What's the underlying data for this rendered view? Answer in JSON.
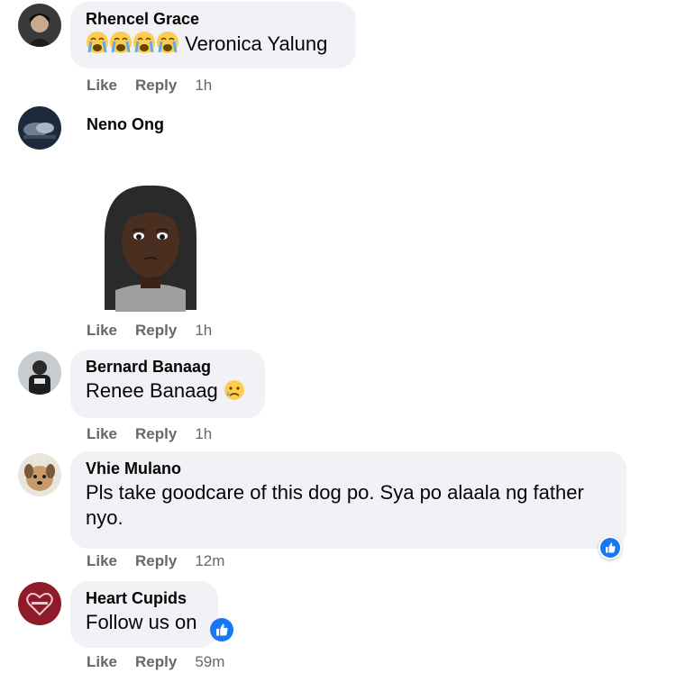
{
  "comments": [
    {
      "author": "Rhencel Grace",
      "text": "Veronica Yalung",
      "emoji_prefix": [
        "crying-face",
        "crying-face",
        "crying-face",
        "crying-face"
      ],
      "actions": {
        "like": "Like",
        "reply": "Reply",
        "time": "1h"
      }
    },
    {
      "author": "Neno Ong",
      "sticker": "avatar-sticker-sad",
      "actions": {
        "like": "Like",
        "reply": "Reply",
        "time": "1h"
      }
    },
    {
      "author": "Bernard Banaag",
      "text": "Renee Banaag",
      "emoji_suffix": "sad-tear-face",
      "actions": {
        "like": "Like",
        "reply": "Reply",
        "time": "1h"
      }
    },
    {
      "author": "Vhie Mulano",
      "text": "Pls take goodcare of this dog po. Sya po alaala ng father nyo.",
      "reaction": "like",
      "actions": {
        "like": "Like",
        "reply": "Reply",
        "time": "12m"
      }
    },
    {
      "author": "Heart Cupids",
      "text": "Follow us on",
      "inline_icon": "like-icon",
      "actions": {
        "like": "Like",
        "reply": "Reply",
        "time": "59m"
      }
    }
  ],
  "colors": {
    "bubble": "#f0f2f5",
    "meta": "#65676b",
    "like_blue": "#1877f2"
  }
}
